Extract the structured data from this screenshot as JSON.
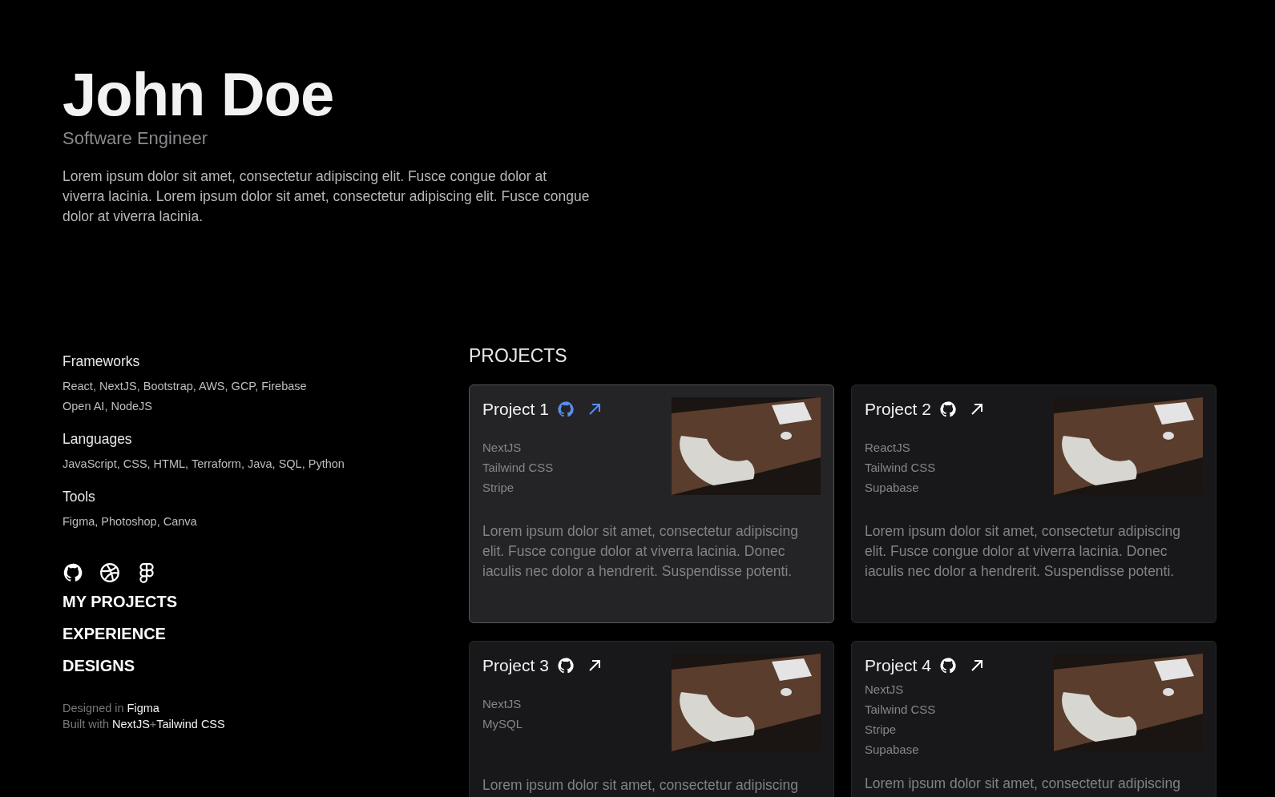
{
  "header": {
    "name": "John Doe",
    "title": "Software Engineer",
    "bio": "Lorem ipsum dolor sit amet, consectetur adipiscing elit. Fusce congue dolor at viverra lacinia. Lorem ipsum dolor sit amet, consectetur adipiscing elit. Fusce congue dolor at viverra lacinia."
  },
  "skills": [
    {
      "heading": "Frameworks",
      "lines": [
        "React, NextJS, Bootstrap, AWS, GCP, Firebase",
        "Open AI, NodeJS"
      ]
    },
    {
      "heading": "Languages",
      "lines": [
        "JavaScript, CSS, HTML, Terraform, Java, SQL, Python"
      ]
    },
    {
      "heading": "Tools",
      "lines": [
        "Figma, Photoshop, Canva"
      ]
    }
  ],
  "social_links": [
    {
      "kind": "github"
    },
    {
      "kind": "dribbble"
    },
    {
      "kind": "figma"
    }
  ],
  "nav": [
    "MY PROJECTS",
    "EXPERIENCE",
    "DESIGNS"
  ],
  "footer": [
    {
      "parts": [
        {
          "text": "Designed in ",
          "accent": false
        },
        {
          "text": "Figma",
          "accent": true
        }
      ]
    },
    {
      "parts": [
        {
          "text": "Built with ",
          "accent": false
        },
        {
          "text": "NextJS",
          "accent": true
        },
        {
          "text": "+",
          "accent": false
        },
        {
          "text": "Tailwind CSS",
          "accent": true
        }
      ]
    }
  ],
  "projects": {
    "heading": "PROJECTS",
    "items": [
      {
        "title": "Project 1",
        "selected": true,
        "tech": [
          "NextJS",
          "Tailwind CSS",
          "Stripe"
        ],
        "description": "Lorem ipsum dolor sit amet, consectetur adipiscing elit. Fusce congue dolor at viverra lacinia. Donec iaculis nec dolor a hendrerit. Suspendisse potenti."
      },
      {
        "title": "Project 2",
        "selected": false,
        "tech": [
          "ReactJS",
          "Tailwind CSS",
          "Supabase"
        ],
        "description": "Lorem ipsum dolor sit amet, consectetur adipiscing elit. Fusce congue dolor at viverra lacinia. Donec iaculis nec dolor a hendrerit. Suspendisse potenti."
      },
      {
        "title": "Project 3",
        "selected": false,
        "tech": [
          "NextJS",
          "MySQL"
        ],
        "description": "Lorem ipsum dolor sit amet, consectetur adipiscing"
      },
      {
        "title": "Project 4",
        "selected": false,
        "tech": [
          "NextJS",
          "Tailwind CSS",
          "Stripe",
          "Supabase"
        ],
        "description": "Lorem ipsum dolor sit amet, consectetur adipiscing"
      }
    ]
  }
}
